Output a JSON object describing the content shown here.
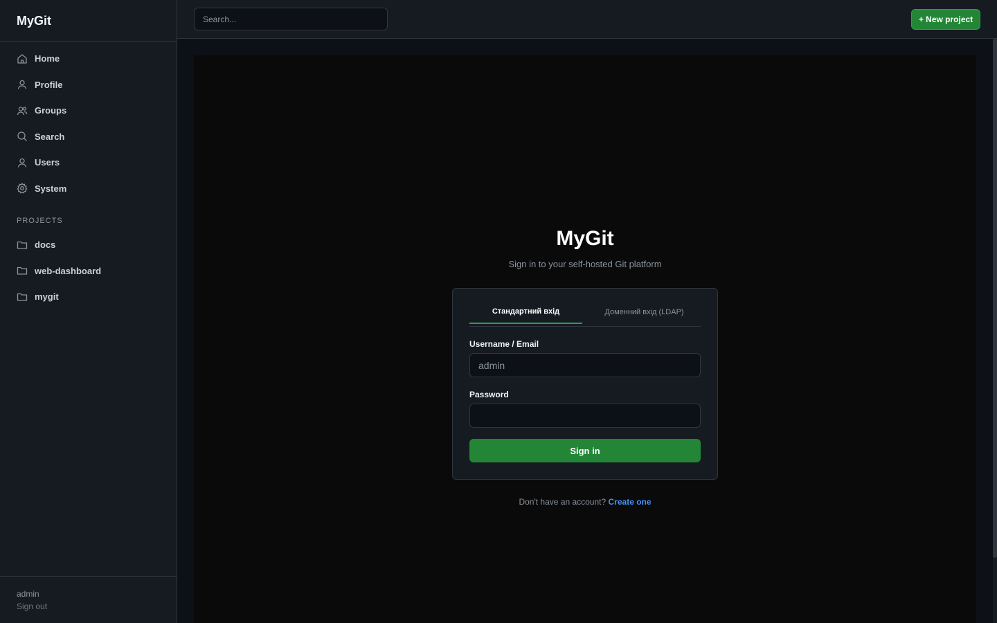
{
  "sidebar": {
    "brand": "MyGit",
    "nav": [
      {
        "label": "Home",
        "icon": "home-icon"
      },
      {
        "label": "Profile",
        "icon": "user-icon"
      },
      {
        "label": "Groups",
        "icon": "users-icon"
      },
      {
        "label": "Search",
        "icon": "search-icon"
      },
      {
        "label": "Users",
        "icon": "user-icon"
      },
      {
        "label": "System",
        "icon": "gear-icon"
      }
    ],
    "projects_label": "PROJECTS",
    "projects": [
      {
        "label": "docs",
        "icon": "folder-icon"
      },
      {
        "label": "web-dashboard",
        "icon": "folder-icon"
      },
      {
        "label": "mygit",
        "icon": "folder-icon"
      }
    ],
    "footer": {
      "username": "admin",
      "signout": "Sign out"
    }
  },
  "topbar": {
    "search_placeholder": "Search...",
    "new_project_label": "+ New project"
  },
  "login": {
    "title": "MyGit",
    "subtitle": "Sign in to your self-hosted Git platform",
    "tabs": [
      {
        "label": "Стандартний вхід",
        "active": true
      },
      {
        "label": "Доменний вхід (LDAP)",
        "active": false
      }
    ],
    "username_label": "Username / Email",
    "username_placeholder": "admin",
    "password_label": "Password",
    "password_value": "",
    "signin_label": "Sign in",
    "signup_text": "Don't have an account?",
    "signup_link": "Create one"
  },
  "colors": {
    "accent_green": "#238636",
    "link_blue": "#4493f8",
    "sidebar_bg": "#161b22",
    "page_bg": "#0d1117"
  }
}
